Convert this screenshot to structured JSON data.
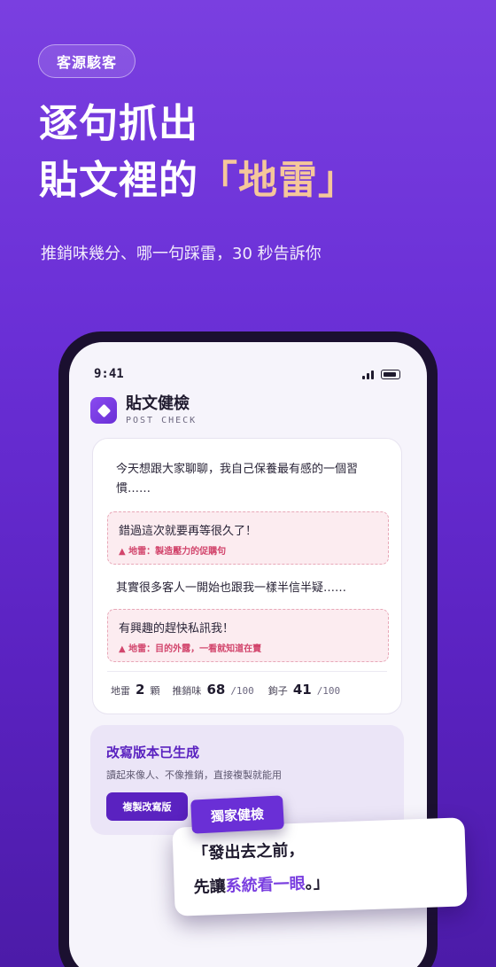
{
  "hero": {
    "tag": "客源駭客",
    "headline_line1": "逐句抓出",
    "headline_line2_prefix": "貼文裡的",
    "headline_line2_highlight": "「地雷」",
    "subhead": "推銷味幾分、哪一句踩雷，30 秒告訴你"
  },
  "phone": {
    "status_time": "9:41",
    "app_title": "貼文健檢",
    "app_subtitle": "POST CHECK",
    "post": {
      "paragraph1": "今天想跟大家聊聊，我自己保養最有感的一個習慣……",
      "warning1_text": "錯過這次就要再等很久了！",
      "warning1_mark": "▲ 地雷：製造壓力的促購句",
      "paragraph2": "其實很多客人一開始也跟我一樣半信半疑……",
      "warning2_text": "有興趣的趕快私訊我！",
      "warning2_mark": "▲ 地雷：目的外露，一看就知道在賣"
    },
    "stats": {
      "mines_label": "地雷",
      "mines_value": "2",
      "mines_unit": "顆",
      "sales_label": "推銷味",
      "sales_value": "68",
      "sales_max": "/100",
      "hook_label": "鉤子",
      "hook_value": "41",
      "hook_max": "/100"
    },
    "rewrite": {
      "title": "改寫版本已生成",
      "subtitle": "讀起來像人、不像推銷，直接複製就能用",
      "button": "複製改寫版"
    }
  },
  "overlay": {
    "badge": "獨家健檢",
    "quote_line1": "「發出去之前，",
    "quote_line2_prefix": "先讓",
    "quote_line2_accent": "系統看一眼",
    "quote_line2_suffix": "。」"
  },
  "colors": {
    "background": "#6a2fd6",
    "highlight": "#f5c79a",
    "warning": "#d2456c",
    "accent": "#5a22c0"
  }
}
